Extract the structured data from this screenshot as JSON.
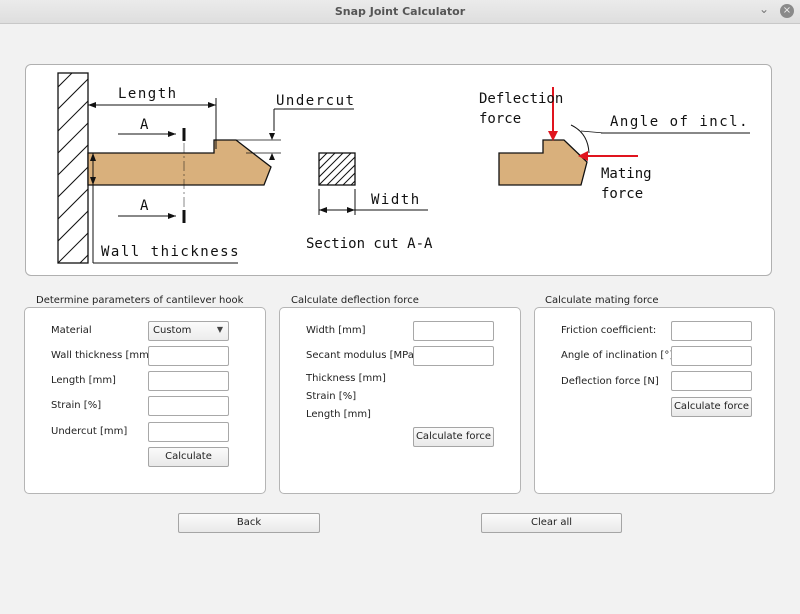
{
  "window": {
    "title": "Snap Joint Calculator",
    "minimize_glyph": "⌄",
    "close_glyph": "×"
  },
  "diagram": {
    "length": "Length",
    "undercut": "Undercut",
    "section_a_top": "A",
    "section_a_bottom": "A",
    "wall_thickness": "Wall thickness",
    "width": "Width",
    "section_cut": "Section cut A-A",
    "deflection_force_1": "Deflection",
    "deflection_force_2": "force",
    "angle_of_incl": "Angle of incl.",
    "mating_force_1": "Mating",
    "mating_force_2": "force",
    "colors": {
      "hook": "#d9b07c",
      "arrow": "#e0141e"
    }
  },
  "cantilever": {
    "title": "Determine parameters of cantilever hook",
    "material_label": "Material",
    "material_value": "Custom",
    "wall_thickness_label": "Wall thickness [mm]",
    "length_label": "Length [mm]",
    "strain_label": "Strain [%]",
    "undercut_label": "Undercut [mm]",
    "calculate_label": "Calculate"
  },
  "deflection": {
    "title": "Calculate deflection force",
    "width_label": "Width [mm]",
    "secant_label": "Secant modulus [MPa]",
    "thickness_label": "Thickness [mm]",
    "strain_label": "Strain [%]",
    "length_label": "Length [mm]",
    "calculate_label": "Calculate force"
  },
  "mating": {
    "title": "Calculate mating force",
    "friction_label": "Friction coefficient:",
    "angle_label": "Angle of inclination [°]:",
    "deflection_label": "Deflection force [N]",
    "calculate_label": "Calculate force"
  },
  "footer": {
    "back_label": "Back",
    "clear_label": "Clear all"
  }
}
